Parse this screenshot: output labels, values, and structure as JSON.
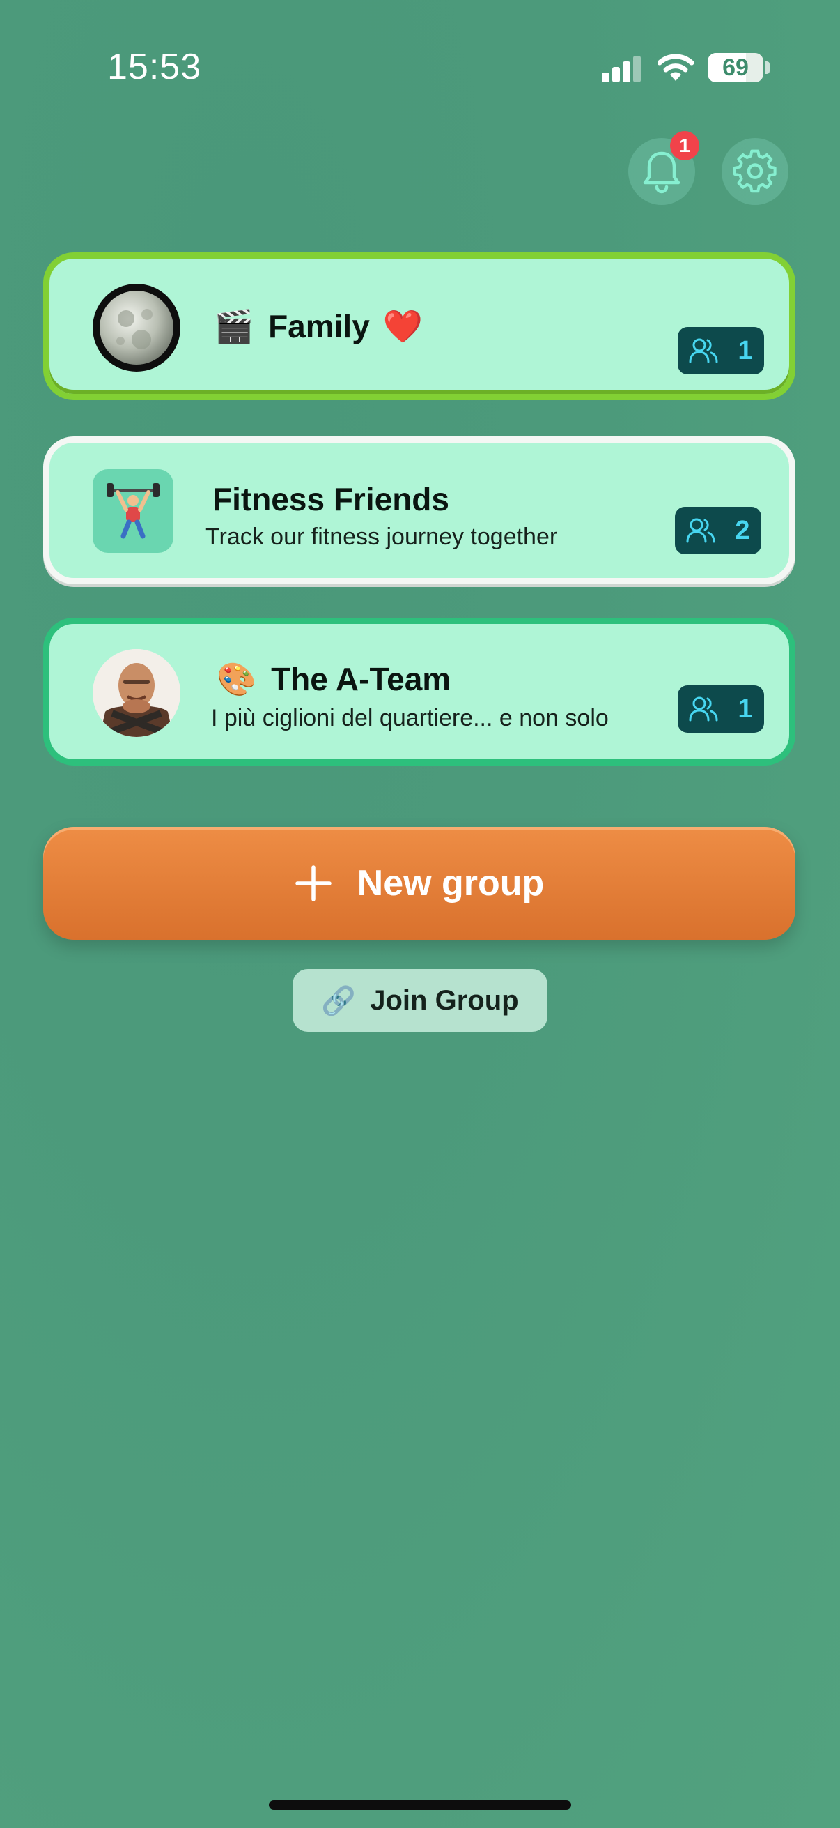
{
  "status_bar": {
    "time": "15:53",
    "battery_percent": "69",
    "battery_level": 0.69,
    "signal_bars": 3
  },
  "header": {
    "notifications": {
      "icon": "bell-icon",
      "badge_count": "1"
    },
    "settings": {
      "icon": "gear-icon"
    }
  },
  "groups": [
    {
      "name": "Family",
      "title_emoji": "🎬",
      "suffix_emoji": "❤️",
      "description": "",
      "member_count": "1",
      "avatar": "moon-avatar",
      "border_color": "#82d034"
    },
    {
      "name": "Fitness Friends",
      "title_emoji": "",
      "description": "Track our fitness journey together",
      "member_count": "2",
      "avatar": "weightlifter-avatar",
      "border_color": "#f4f7f4"
    },
    {
      "name": "The A-Team",
      "title_emoji": "🎨",
      "description": "I più ciglioni del quartiere... e non solo",
      "member_count": "1",
      "avatar": "character-avatar",
      "border_color": "#2dc07c"
    }
  ],
  "actions": {
    "new_group_label": "New group",
    "join_group_label": "Join Group",
    "join_group_emoji": "🔗"
  },
  "colors": {
    "background": "#4c9a7b",
    "card_fill": "#aff5d6",
    "member_badge": "#0d4a4c",
    "member_count_text": "#47d6f0",
    "new_group_button": "#e57f38",
    "notification_badge": "#f1434a"
  }
}
